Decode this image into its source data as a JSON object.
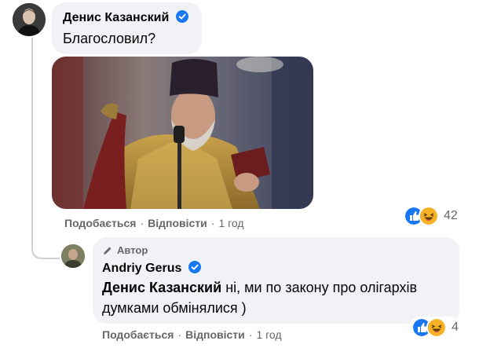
{
  "comment": {
    "author": "Денис Казанский",
    "text": "Благословил?",
    "actions": {
      "like": "Подобається",
      "reply": "Відповісти",
      "time": "1 год"
    },
    "reactions": {
      "count": "42",
      "icons": [
        "like-icon",
        "haha-icon"
      ]
    }
  },
  "reply": {
    "badge": "Автор",
    "author": "Andriy Gerus",
    "mention": "Денис Казанский",
    "text_line1": " ні, ми по закону про олігархів",
    "text_line2": "думками обмінялися )",
    "actions": {
      "like": "Подобається",
      "reply": "Відповісти",
      "time": "1 год"
    },
    "reactions": {
      "count": "4",
      "icons": [
        "like-icon",
        "haha-icon"
      ]
    }
  },
  "colors": {
    "verified": "#1877f2",
    "like": "#1877f2",
    "haha": "#f7b125",
    "bubble": "#f0f2f5",
    "meta": "#65676b"
  }
}
